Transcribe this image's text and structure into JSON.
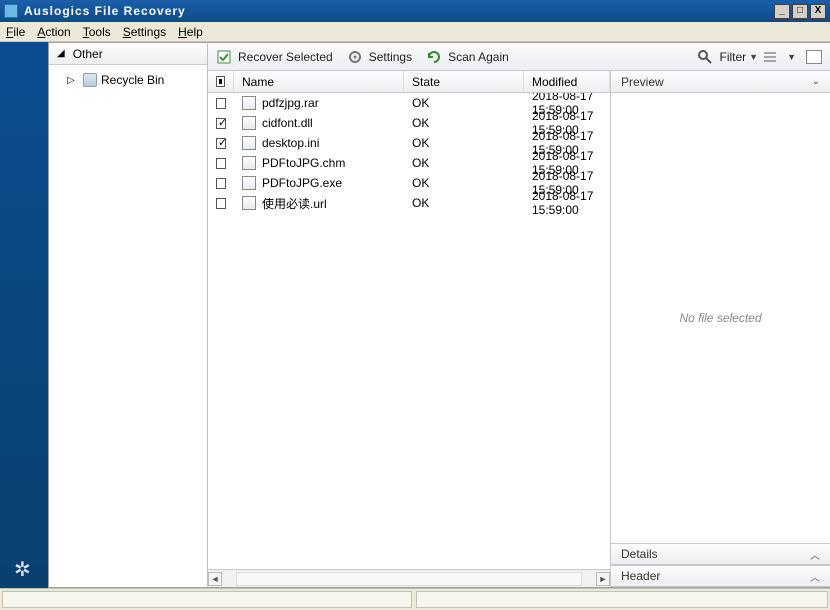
{
  "window": {
    "title": "Auslogics File Recovery"
  },
  "menubar": {
    "file": "File",
    "action": "Action",
    "tools": "Tools",
    "settings": "Settings",
    "help": "Help"
  },
  "tree": {
    "header": "Other",
    "items": [
      {
        "label": "Recycle Bin"
      }
    ]
  },
  "toolbar": {
    "recover": "Recover Selected",
    "settings": "Settings",
    "scan": "Scan Again",
    "filter": "Filter"
  },
  "columns": {
    "name": "Name",
    "state": "State",
    "modified": "Modified"
  },
  "files": [
    {
      "checked": false,
      "name": "pdfzjpg.rar",
      "state": "OK",
      "modified": "2018-08-17 15:59:00"
    },
    {
      "checked": true,
      "name": "cidfont.dll",
      "state": "OK",
      "modified": "2018-08-17 15:59:00"
    },
    {
      "checked": true,
      "name": "desktop.ini",
      "state": "OK",
      "modified": "2018-08-17 15:59:00"
    },
    {
      "checked": false,
      "name": "PDFtoJPG.chm",
      "state": "OK",
      "modified": "2018-08-17 15:59:00"
    },
    {
      "checked": false,
      "name": "PDFtoJPG.exe",
      "state": "OK",
      "modified": "2018-08-17 15:59:00"
    },
    {
      "checked": false,
      "name": "使用必读.url",
      "state": "OK",
      "modified": "2018-08-17 15:59:00"
    }
  ],
  "right": {
    "preview_header": "Preview",
    "preview_placeholder": "No file selected",
    "details_header": "Details",
    "header_header": "Header"
  }
}
